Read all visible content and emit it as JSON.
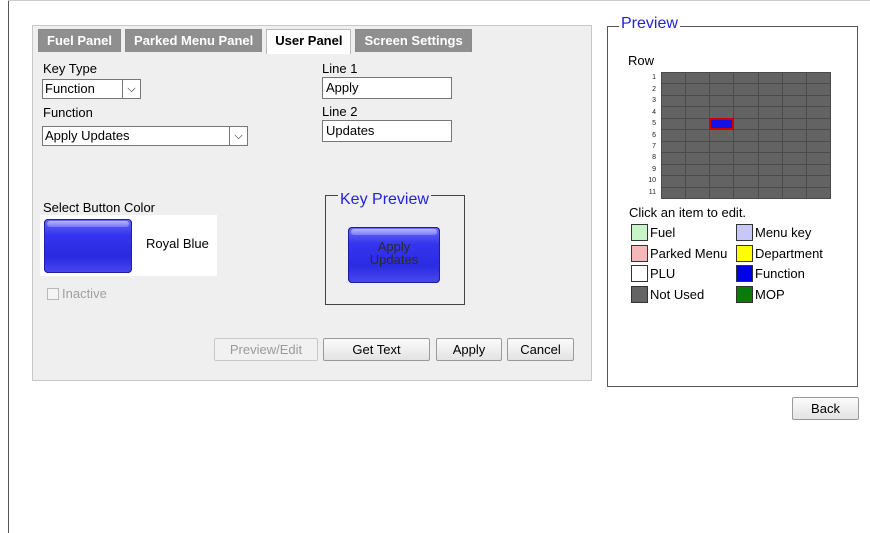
{
  "tabs": [
    "Fuel Panel",
    "Parked Menu Panel",
    "User Panel",
    "Screen Settings"
  ],
  "active_tab": "User Panel",
  "form": {
    "key_type_label": "Key Type",
    "key_type_value": "Function",
    "function_label": "Function",
    "function_value": "Apply Updates",
    "line1_label": "Line 1",
    "line1_value": "Apply",
    "line2_label": "Line 2",
    "line2_value": "Updates",
    "select_color_label": "Select Button Color",
    "color_name": "Royal Blue",
    "inactive_label": "Inactive",
    "inactive_checked": false
  },
  "key_preview": {
    "title": "Key Preview",
    "line1": "Apply",
    "line2": "Updates",
    "color": "#3232ee"
  },
  "buttons": {
    "preview_edit": "Preview/Edit",
    "get_text": "Get Text",
    "apply": "Apply",
    "cancel": "Cancel",
    "back": "Back"
  },
  "preview": {
    "title": "Preview",
    "row_label": "Row",
    "rows": [
      "1",
      "2",
      "3",
      "4",
      "5",
      "6",
      "7",
      "8",
      "9",
      "10",
      "11"
    ],
    "columns": 7,
    "highlighted_cell": {
      "row": 5,
      "col": 3
    },
    "hint": "Click an item to edit."
  },
  "legend": [
    {
      "label": "Fuel",
      "color": "#c8f5c8"
    },
    {
      "label": "Menu key",
      "color": "#c8c8f8"
    },
    {
      "label": "Parked Menu",
      "color": "#f5b8b8"
    },
    {
      "label": "Department",
      "color": "#ffff00"
    },
    {
      "label": "PLU",
      "color": "#ffffff"
    },
    {
      "label": "Function",
      "color": "#0000e8"
    },
    {
      "label": "Not Used",
      "color": "#646464"
    },
    {
      "label": "MOP",
      "color": "#0a7a0a"
    }
  ]
}
